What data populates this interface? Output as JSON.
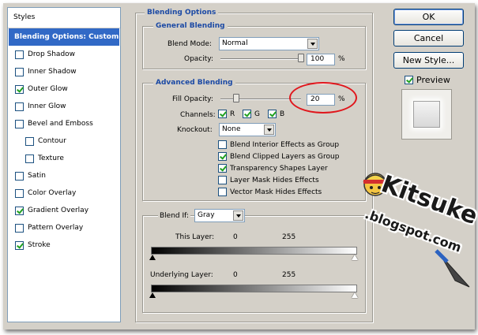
{
  "styles_panel": {
    "header": "Styles",
    "items": [
      {
        "label": "Blending Options: Custom",
        "selected": true,
        "checkbox": false,
        "checked": false,
        "sub": false
      },
      {
        "label": "Drop Shadow",
        "selected": false,
        "checkbox": true,
        "checked": false,
        "sub": false
      },
      {
        "label": "Inner Shadow",
        "selected": false,
        "checkbox": true,
        "checked": false,
        "sub": false
      },
      {
        "label": "Outer Glow",
        "selected": false,
        "checkbox": true,
        "checked": true,
        "sub": false
      },
      {
        "label": "Inner Glow",
        "selected": false,
        "checkbox": true,
        "checked": false,
        "sub": false
      },
      {
        "label": "Bevel and Emboss",
        "selected": false,
        "checkbox": true,
        "checked": false,
        "sub": false
      },
      {
        "label": "Contour",
        "selected": false,
        "checkbox": true,
        "checked": false,
        "sub": true
      },
      {
        "label": "Texture",
        "selected": false,
        "checkbox": true,
        "checked": false,
        "sub": true
      },
      {
        "label": "Satin",
        "selected": false,
        "checkbox": true,
        "checked": false,
        "sub": false
      },
      {
        "label": "Color Overlay",
        "selected": false,
        "checkbox": true,
        "checked": false,
        "sub": false
      },
      {
        "label": "Gradient Overlay",
        "selected": false,
        "checkbox": true,
        "checked": true,
        "sub": false
      },
      {
        "label": "Pattern Overlay",
        "selected": false,
        "checkbox": true,
        "checked": false,
        "sub": false
      },
      {
        "label": "Stroke",
        "selected": false,
        "checkbox": true,
        "checked": true,
        "sub": false
      }
    ]
  },
  "blending_options": {
    "title": "Blending Options",
    "general": {
      "title": "General Blending",
      "blend_mode_label": "Blend Mode:",
      "blend_mode_value": "Normal",
      "opacity_label": "Opacity:",
      "opacity_value": "100",
      "opacity_unit": "%",
      "opacity_fraction": 1.0
    },
    "advanced": {
      "title": "Advanced Blending",
      "fill_opacity_label": "Fill Opacity:",
      "fill_opacity_value": "20",
      "fill_opacity_unit": "%",
      "fill_opacity_fraction": 0.2,
      "channels_label": "Channels:",
      "channels": [
        {
          "label": "R",
          "checked": true
        },
        {
          "label": "G",
          "checked": true
        },
        {
          "label": "B",
          "checked": true
        }
      ],
      "knockout_label": "Knockout:",
      "knockout_value": "None",
      "options": [
        {
          "label": "Blend Interior Effects as Group",
          "checked": false
        },
        {
          "label": "Blend Clipped Layers as Group",
          "checked": true
        },
        {
          "label": "Transparency Shapes Layer",
          "checked": true
        },
        {
          "label": "Layer Mask Hides Effects",
          "checked": false
        },
        {
          "label": "Vector Mask Hides Effects",
          "checked": false
        }
      ]
    },
    "blend_if": {
      "label": "Blend If:",
      "value": "Gray",
      "this_layer_label": "This Layer:",
      "this_layer_low": "0",
      "this_layer_high": "255",
      "underlying_label": "Underlying Layer:",
      "underlying_low": "0",
      "underlying_high": "255"
    }
  },
  "buttons": {
    "ok": "OK",
    "cancel": "Cancel",
    "new_style": "New Style...",
    "preview_label": "Preview",
    "preview_checked": true
  },
  "watermark": {
    "line1": "Kitsuke",
    "line2": ".blogspot.com"
  },
  "colors": {
    "selection": "#3169c6",
    "group_title": "#1c4aa5",
    "highlight_ellipse": "#e0161c",
    "dialog_bg": "#d4d0c8"
  }
}
